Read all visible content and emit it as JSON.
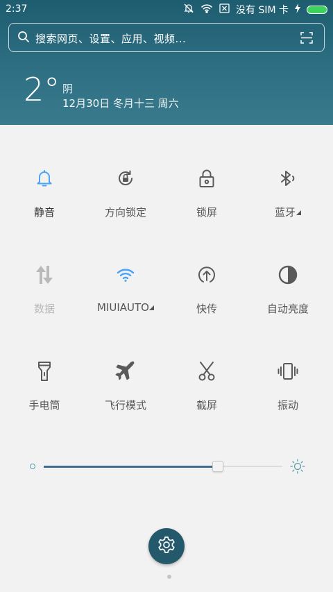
{
  "status": {
    "time": "2:37",
    "carrier": "没有 SIM 卡"
  },
  "search": {
    "placeholder": "搜索网页、设置、应用、视频..."
  },
  "weather": {
    "temperature": "2°",
    "condition": "阴",
    "date": "12月30日 冬月十三 周六"
  },
  "tiles": [
    {
      "label": "静音",
      "icon": "bell-icon",
      "state": "on"
    },
    {
      "label": "方向锁定",
      "icon": "rotation-lock-icon"
    },
    {
      "label": "锁屏",
      "icon": "lock-icon"
    },
    {
      "label": "蓝牙",
      "icon": "bluetooth-icon",
      "has_menu": true
    },
    {
      "label": "数据",
      "icon": "mobile-data-icon",
      "state": "disabled"
    },
    {
      "label": "MIUIAUTO",
      "icon": "wifi-icon",
      "state": "on",
      "has_menu": true
    },
    {
      "label": "快传",
      "icon": "quick-share-icon"
    },
    {
      "label": "自动亮度",
      "icon": "auto-brightness-icon"
    },
    {
      "label": "手电筒",
      "icon": "flashlight-icon"
    },
    {
      "label": "飞行模式",
      "icon": "airplane-icon"
    },
    {
      "label": "截屏",
      "icon": "screenshot-scissors-icon"
    },
    {
      "label": "振动",
      "icon": "vibrate-icon"
    }
  ],
  "brightness": {
    "level": 0.73
  },
  "colors": {
    "header": "#2b6a7e",
    "accent": "#4aa3f5",
    "tile_icon": "#555555",
    "disabled": "#b9b9b9"
  }
}
